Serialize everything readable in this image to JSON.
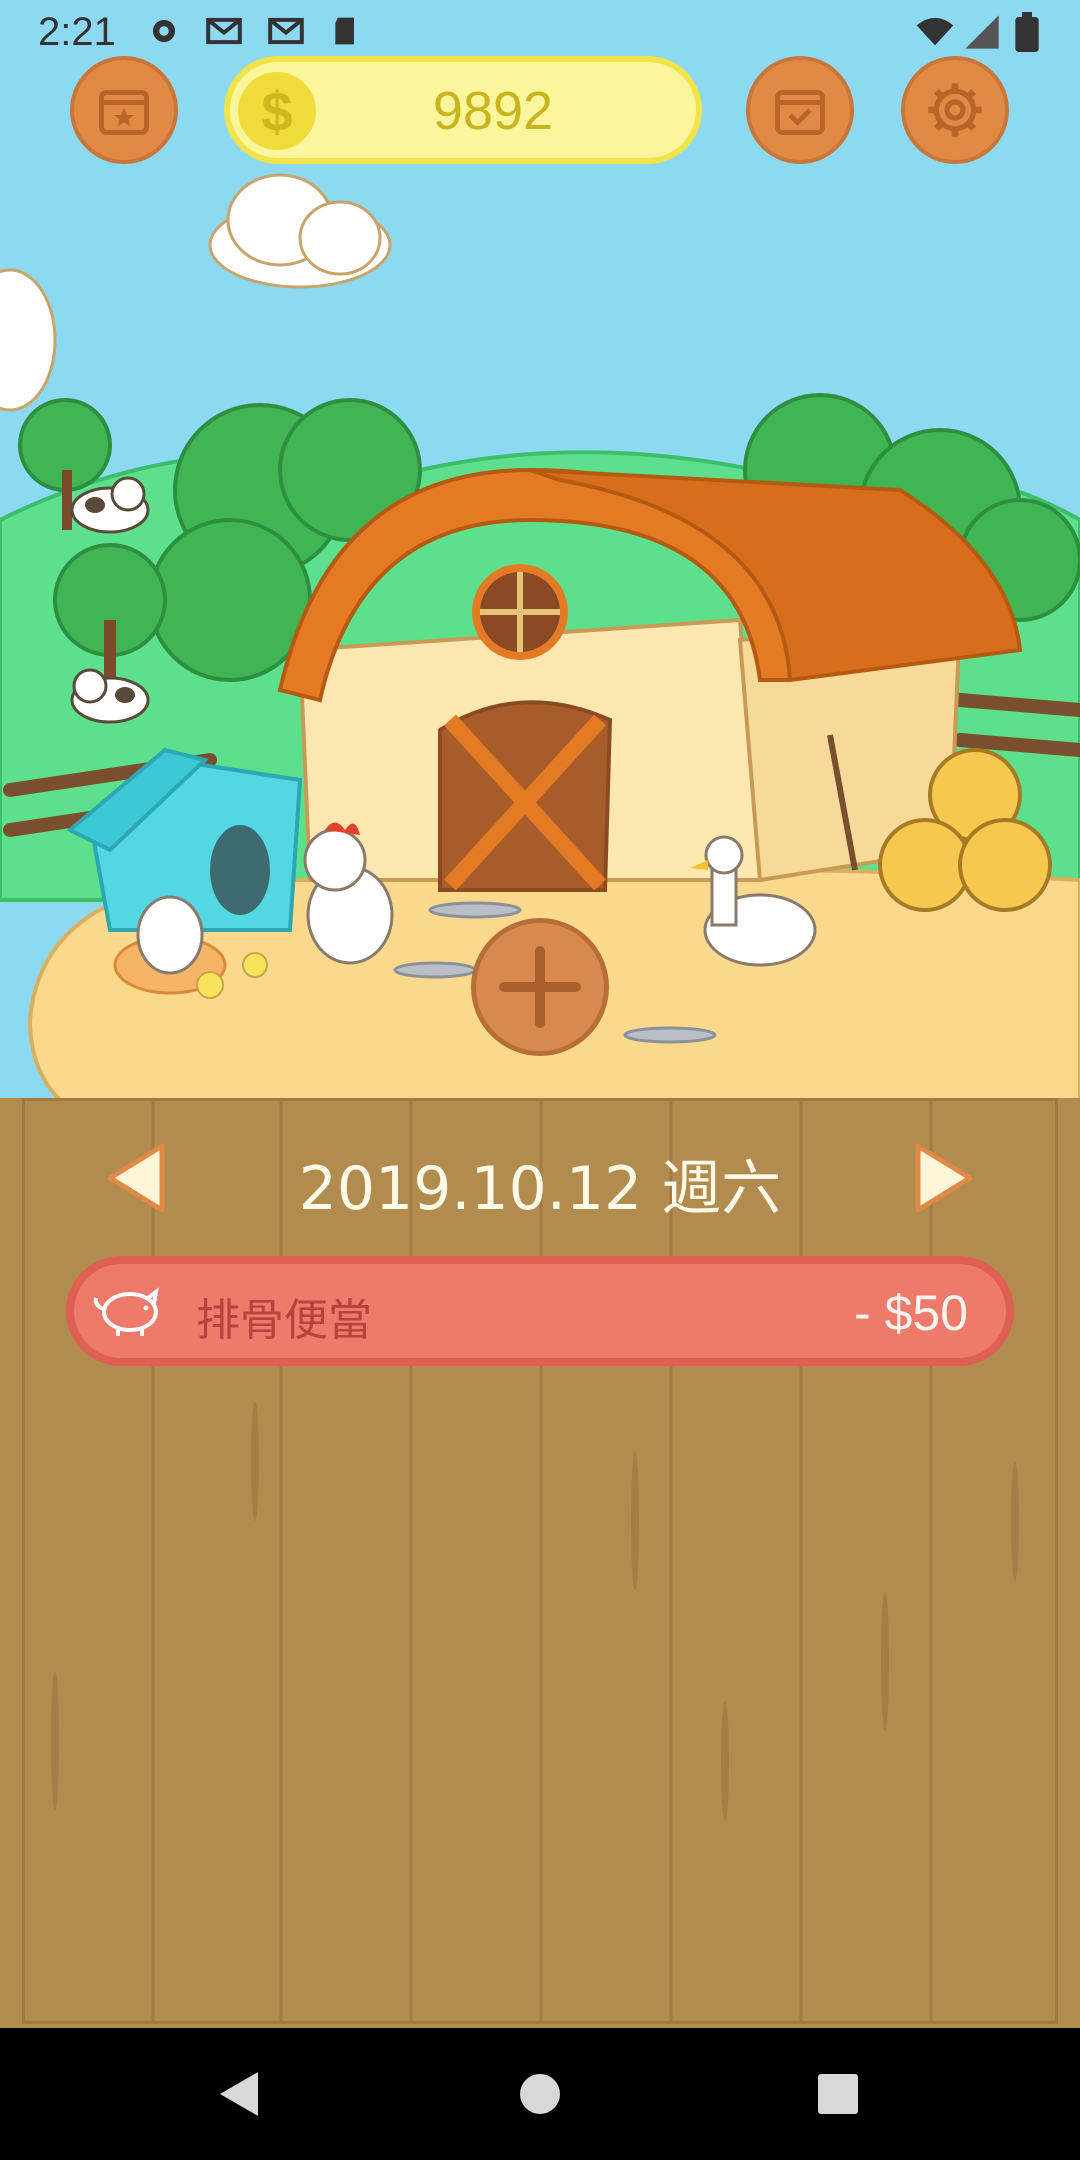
{
  "status_bar": {
    "time": "2:21",
    "icons": [
      "settings-icon",
      "gmail-icon",
      "gmail-icon",
      "sd-card-icon",
      "wifi-icon",
      "signal-icon",
      "battery-icon"
    ]
  },
  "top_bar": {
    "left_button_icon": "calendar-star-icon",
    "coin_symbol": "$",
    "coin_balance": "9892",
    "checkin_button_icon": "calendar-check-icon",
    "settings_button_icon": "gear-icon"
  },
  "scene": {
    "description_icons": [
      "barn",
      "chicken",
      "duck",
      "hen-with-chicks",
      "cows",
      "hay-bales",
      "trees",
      "clouds"
    ],
    "add_button_icon": "plus-icon"
  },
  "date_nav": {
    "date_label": "2019.10.12 週六",
    "prev_icon": "triangle-left-icon",
    "next_icon": "triangle-right-icon"
  },
  "entries": [
    {
      "icon": "piggy-bank-icon",
      "name": "排骨便當",
      "amount": "- $50"
    }
  ],
  "colors": {
    "sky": "#8ED9F2",
    "wood": "#B28B4F",
    "entry_bg": "#EE7A6C",
    "coin_pill": "#FBF59C",
    "button_orange": "#E08A46"
  },
  "nav_bar": {
    "back_icon": "back-icon",
    "home_icon": "home-icon",
    "recents_icon": "recents-icon"
  }
}
